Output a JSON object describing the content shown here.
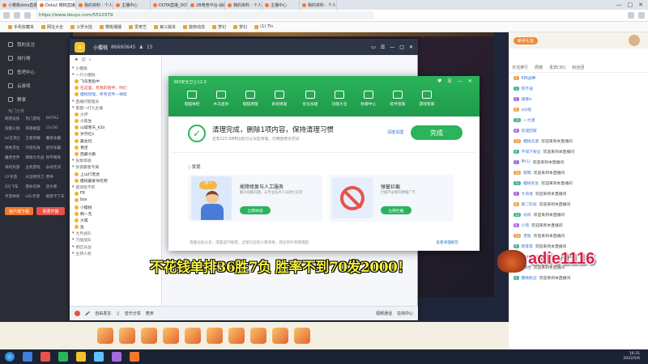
{
  "browser": {
    "tabs": [
      "小樱桃dota直播间",
      "Dota2 樱桃直播_D",
      "我的资料 - 个人中",
      "主播中心",
      "DOTA直播_DOTA视",
      "2B电竞平台-战绩中",
      "我的资料 - 个人中",
      "主播中心",
      "我的资料 - 个人中"
    ],
    "url": "https://www.douyu.com/5510379",
    "bookmarks": [
      "手机收藏夹",
      "网址大全",
      "斗罗大陆",
      "樱桃播播",
      "爱奇艺",
      "第三版本",
      "旋转动态",
      "梦幻",
      "梦幻",
      "(1) Tin"
    ]
  },
  "leftnav": {
    "items": [
      "我的关注",
      "排行榜",
      "鱼吧中心",
      "云游戏",
      "赛事"
    ],
    "section": "热门分类",
    "categories": [
      "网游竞技",
      "热门游戏",
      "DOTA2",
      "穿越火线",
      "英雄联盟",
      "CS:GO",
      "lol云顶之",
      "王者荣耀",
      "魔兽争霸",
      "绝地求生",
      "守望先锋",
      "星际争霸",
      "魔兽世界",
      "球球大作战",
      "和平精英",
      "单机热游",
      "主机游戏",
      "永劫无间",
      "CF手游",
      "天涯明月刀",
      "原神",
      "QQ飞车",
      "使命召唤",
      "逆水寒",
      "手游休闲",
      "LOL手游",
      "跑跑卡丁车"
    ],
    "btn_left": "客户端下载",
    "btn_right": "我要开播"
  },
  "qq": {
    "title": "小樱桃",
    "number": "86660645",
    "count": "15",
    "members": [
      {
        "name": "小樱桃",
        "type": "cat"
      },
      {
        "name": "一只小樱桃",
        "type": "cat"
      },
      {
        "name": "飞鸟我鱼中",
        "type": "normal"
      },
      {
        "name": "在这里，有我的陪伴，你们",
        "type": "red"
      },
      {
        "name": "樱桃管理，所有宣传一律禁",
        "type": "blue"
      },
      {
        "name": "直播间管理员",
        "type": "cat"
      },
      {
        "name": "雷霆一打九主播",
        "type": "cat"
      },
      {
        "name": "小汐",
        "type": "normal"
      },
      {
        "name": "小先生",
        "type": "normal"
      },
      {
        "name": "山城寒天_k2o",
        "type": "normal"
      },
      {
        "name": "岁月红s",
        "type": "normal"
      },
      {
        "name": "最会玩",
        "type": "normal"
      },
      {
        "name": "青佳",
        "type": "normal"
      },
      {
        "name": "西藏大鹏",
        "type": "normal"
      },
      {
        "name": "张数等级",
        "type": "cat"
      },
      {
        "name": "张雷霸者专属",
        "type": "cat"
      },
      {
        "name": "上山打老虎",
        "type": "normal"
      },
      {
        "name": "樱桃最爱你吃吧",
        "type": "normal"
      },
      {
        "name": "观测帮不死",
        "type": "cat"
      },
      {
        "name": "F8",
        "type": "normal"
      },
      {
        "name": "bos",
        "type": "normal"
      },
      {
        "name": "小樱桃",
        "type": "normal"
      },
      {
        "name": "韩一无",
        "type": "normal"
      },
      {
        "name": "大咸",
        "type": "normal"
      },
      {
        "name": "鱼",
        "type": "normal"
      },
      {
        "name": "大月战队",
        "type": "cat"
      },
      {
        "name": "万能战队",
        "type": "cat"
      },
      {
        "name": "街区对战",
        "type": "cat"
      },
      {
        "name": "主持人机",
        "type": "cat"
      }
    ],
    "bottom_items": [
      "自由发言",
      "音乐分享",
      "麦序",
      "视频通话",
      "在线中心"
    ]
  },
  "dialog": {
    "title": "360安全卫士12.0",
    "tools": [
      "电脑体检",
      "木马查杀",
      "电脑清理",
      "系统修复",
      "优化加速",
      "功能大全",
      "防御中心",
      "软件管家",
      "游戏管家"
    ],
    "clean_title": "清理完成，删除1项内容，保持清理习惯",
    "clean_sub": "还有225.9MB垃圾可以深度清理，可释放更多空间",
    "recheck": "深度清理",
    "done": "完成",
    "discover_label": "发现",
    "cards": [
      {
        "title": "故障修复与人工服务",
        "desc": "解决电脑问题，与专业技术人员进行交流",
        "btn": "立即体验"
      },
      {
        "title": "弹窗拦截",
        "desc": "拦截不必要的弹窗广告",
        "btn": "立即拦截"
      }
    ],
    "footer_text": "电脑垃圾过多，电脑运行缓慢，全球已出现大量病毒，建议及时清理电脑",
    "footer_link": "查看清理报告"
  },
  "right": {
    "tabs": [
      "日活排行",
      "周榜",
      "贵宾(30)",
      "粉丝团"
    ],
    "banner": "新手礼包",
    "chat": [
      {
        "lvl": "1",
        "nick": "KIN战神",
        "msg": ""
      },
      {
        "lvl": "3",
        "nick": "阿不迪",
        "msg": ""
      },
      {
        "lvl": "5",
        "nick": "骑者a",
        "msg": ""
      },
      {
        "lvl": "6",
        "nick": "x分组",
        "msg": ""
      },
      {
        "lvl": "15",
        "nick": "一大蛋",
        "msg": ""
      },
      {
        "lvl": "8",
        "nick": "欢迎回家",
        "msg": ""
      },
      {
        "lvl": "12",
        "nick": "樱桃兄弟",
        "msg": "欢迎来到本直播间"
      },
      {
        "lvl": "9",
        "nick": "不如下粉丝",
        "msg": "欢迎来到本直播间"
      },
      {
        "lvl": "7",
        "nick": "Mr.Li",
        "msg": "欢迎来到本直播间"
      },
      {
        "lvl": "10",
        "nick": "嗯嗯",
        "msg": "欢迎来到本直播间"
      },
      {
        "lvl": "11",
        "nick": "樱桃先生",
        "msg": "欢迎来到本直播间"
      },
      {
        "lvl": "5",
        "nick": "大哥进",
        "msg": "欢迎来到本直播间"
      },
      {
        "lvl": "6",
        "nick": "第二阶段",
        "msg": "欢迎来到本直播间"
      },
      {
        "lvl": "12",
        "nick": "光标",
        "msg": "欢迎来到本直播间"
      },
      {
        "lvl": "8",
        "nick": "小熊",
        "msg": "欢迎来到本直播间"
      },
      {
        "lvl": "14",
        "nick": "老板",
        "msg": "欢迎来到本直播间"
      },
      {
        "lvl": "9",
        "nick": "嗯等等",
        "msg": "欢迎来到本直播间"
      },
      {
        "lvl": "10",
        "nick": "小樱桃子",
        "msg": "欢迎来到本直播间"
      },
      {
        "lvl": "13",
        "nick": "嘿哈",
        "msg": "欢迎来到本直播间"
      },
      {
        "lvl": "6",
        "nick": "樱桃粉丝",
        "msg": "欢迎来到本直播间"
      }
    ]
  },
  "overlay": {
    "caption": "不花钱单排36胜7负 胜率不到70发2000！",
    "handle": "adie1116"
  },
  "taskbar": {
    "time": "16:31",
    "date": "2022/5/6"
  },
  "colors": {
    "accent_green": "#2bb45a",
    "handle_red": "#d6234a",
    "caption_yellow": "#f3ef3b"
  }
}
